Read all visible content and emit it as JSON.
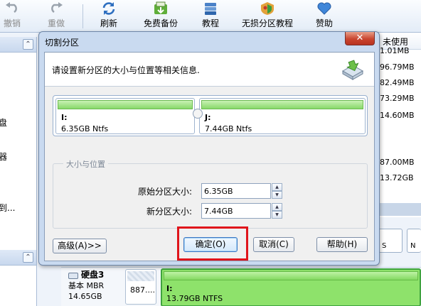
{
  "toolbar": {
    "items": [
      {
        "label": "撤销",
        "icon": "undo-icon",
        "enabled": false
      },
      {
        "label": "重做",
        "icon": "redo-icon",
        "enabled": false
      },
      {
        "label": "刷新",
        "icon": "refresh-icon",
        "enabled": true
      },
      {
        "label": "免费备份",
        "icon": "backup-icon",
        "enabled": true
      },
      {
        "label": "教程",
        "icon": "tutorial-icon",
        "enabled": true
      },
      {
        "label": "无损分区教程",
        "icon": "lossless-partition-icon",
        "enabled": true
      },
      {
        "label": "赞助",
        "icon": "heart-icon",
        "enabled": true
      }
    ]
  },
  "background": {
    "left_texts": [
      "盘",
      "器",
      "到..."
    ],
    "column_header": "未使用",
    "sizes": [
      "1.01MB",
      "96.79MB",
      "82.49MB",
      "73.29MB",
      "14.60MB",
      "87.00MB",
      "13.72GB"
    ],
    "strip_labels": [
      "S",
      "N"
    ],
    "disk": {
      "title": "硬盘3",
      "type": "基本 MBR",
      "size": "14.65GB",
      "small_part_text": "887....",
      "big_part_name": "I:",
      "big_part_info": "13.79GB NTFS"
    }
  },
  "dialog": {
    "title": "切割分区",
    "close_label": "✕",
    "header_text": "请设置新分区的大小与位置等相关信息.",
    "partitions": [
      {
        "name": "I:",
        "info": "6.35GB Ntfs"
      },
      {
        "name": "J:",
        "info": "7.44GB Ntfs"
      }
    ],
    "group_label": "大小与位置",
    "original_label": "原始分区大小:",
    "original_value": "6.35GB",
    "new_label": "新分区大小:",
    "new_value": "7.44GB",
    "buttons": {
      "advanced": "高级(A)>>",
      "ok": "确定(O)",
      "cancel": "取消(C)",
      "help": "帮助(H)"
    }
  },
  "colors": {
    "highlight": "#e0141b",
    "partition_green": "#8ee26b",
    "close_red": "#c9452f"
  }
}
